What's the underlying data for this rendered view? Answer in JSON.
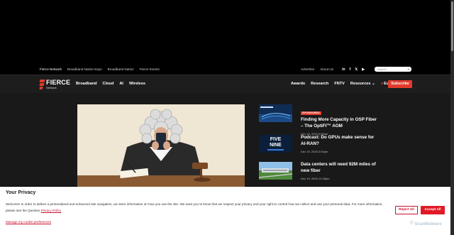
{
  "topbar": {
    "links": [
      "Fierce Network",
      "Broadband Nation Expo",
      "Broadband Nation",
      "Fierce Events"
    ],
    "right_links": [
      "Advertise",
      "About Us"
    ],
    "social_icons": [
      "linkedin-icon",
      "facebook-icon",
      "x-icon",
      "youtube-icon"
    ],
    "search_placeholder": "Search"
  },
  "logo": {
    "wordmark": "FIERCE",
    "sub": "Network"
  },
  "nav": {
    "left": [
      "Broadband",
      "Cloud",
      "AI",
      "Wireless"
    ],
    "right": [
      "Awards",
      "Research",
      "FNTV",
      "Resources"
    ],
    "events_label": "Events",
    "subscribe_label": "Subscribe"
  },
  "sidebar": [
    {
      "badge": "SPONSORED",
      "title": "Finding More Capacity in OSP Fiber – The OptiFI™ AOM",
      "date": "Dec 16, 2025 9:00am"
    },
    {
      "badge": "",
      "title": "Podcast: Do GPUs make sense for AI-RAN?",
      "date": "Dec 19, 2025 3:00pm",
      "thumb_text": [
        "FIVE",
        "NINE"
      ]
    },
    {
      "badge": "",
      "title": "Data centers will need 92M miles of new fiber",
      "date": "Dec 19, 2025 12:45pm"
    }
  ],
  "privacy": {
    "heading": "Your Privacy",
    "message": "Welcome! In order to deliver a personalized and enhanced site navigation, we store information on how you use the site. We want you to know that we respect your privacy and your right to control how we collect and use your personal data. For more information, please see the Questex",
    "policy_link": "Privacy Policy",
    "manage_link": "Manage my cookie preferences",
    "reject_label": "Reject All",
    "accept_label": "Accept All"
  },
  "watermark": "ScanMalware",
  "colors": {
    "accent": "#e23a2c",
    "nav_bg": "#1d1d1d",
    "content_bg": "#191919"
  }
}
